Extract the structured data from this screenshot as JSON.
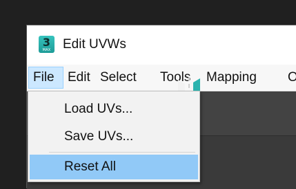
{
  "window": {
    "title": "Edit UVWs",
    "app_icon": {
      "name": "3ds-max-app-icon",
      "number": "3",
      "caption": "MAX",
      "color": "#2bb3ae"
    }
  },
  "menubar": {
    "items": [
      {
        "label": "File",
        "active": true
      },
      {
        "label": "Edit"
      },
      {
        "label": "Select"
      },
      {
        "label": "Tools"
      },
      {
        "label": "Mapping"
      },
      {
        "label": "O"
      }
    ]
  },
  "file_menu": {
    "items": [
      {
        "label": "Load UVs..."
      },
      {
        "label": "Save UVs..."
      },
      {
        "label": "Reset All",
        "highlighted": true
      }
    ]
  },
  "toolbar": {
    "icon": "mirror-flip-icon"
  },
  "colors": {
    "highlight": "#91c9f7",
    "active_menu": "#cce8ff",
    "accent_teal": "#2bb3ae"
  }
}
